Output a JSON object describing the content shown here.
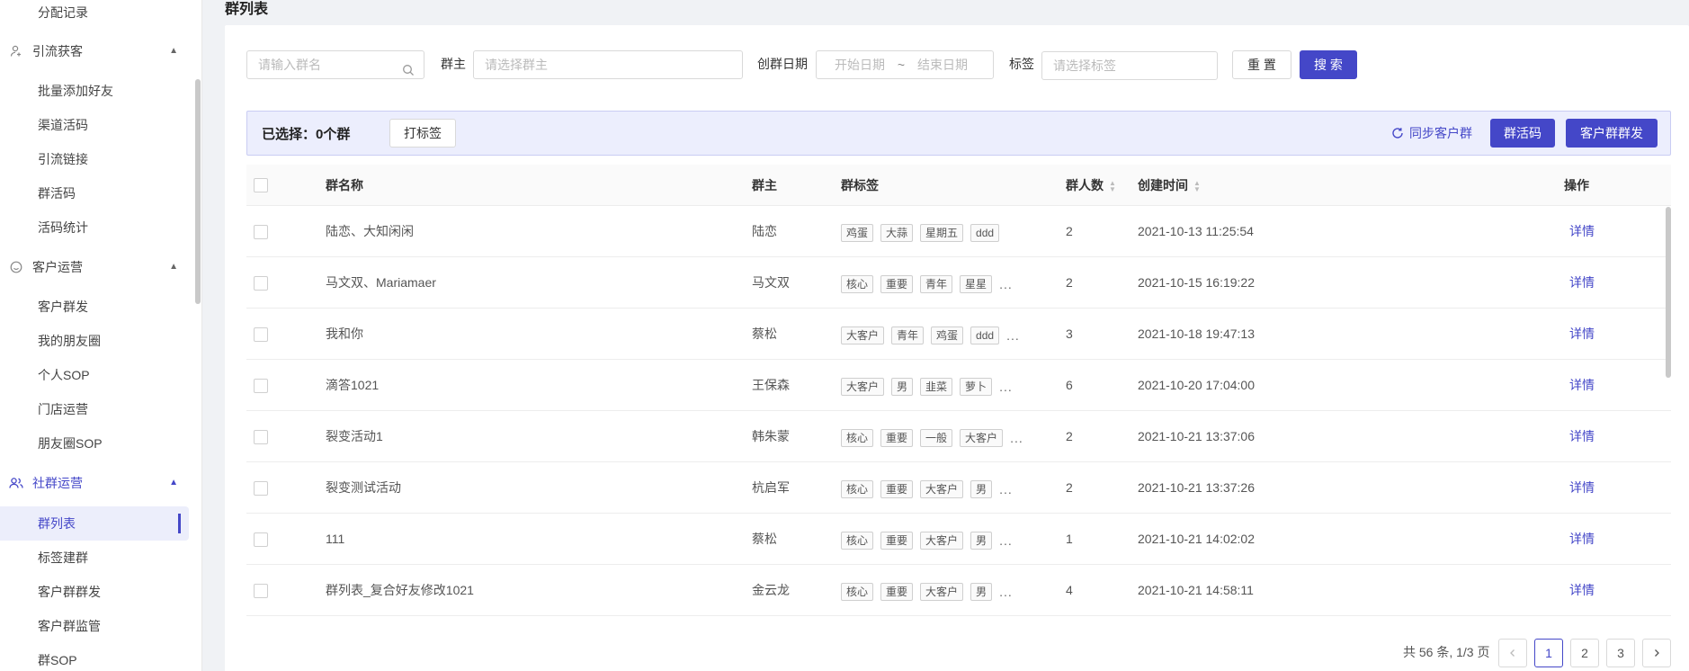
{
  "sidebar": {
    "items_top": [
      "分配记录"
    ],
    "groups": [
      {
        "label": "引流获客",
        "icon": "user-plus-icon",
        "children": [
          "批量添加好友",
          "渠道活码",
          "引流链接",
          "群活码",
          "活码统计"
        ]
      },
      {
        "label": "客户运营",
        "icon": "smile-face-icon",
        "children": [
          "客户群发",
          "我的朋友圈",
          "个人SOP",
          "门店运营",
          "朋友圈SOP"
        ]
      },
      {
        "label": "社群运营",
        "icon": "users-icon",
        "children": [
          "群列表",
          "标签建群",
          "客户群群发",
          "客户群监管",
          "群SOP"
        ]
      }
    ],
    "active_item": "群列表"
  },
  "page": {
    "title": "群列表"
  },
  "filters": {
    "group_name_placeholder": "请输入群名",
    "owner_label": "群主",
    "owner_placeholder": "请选择群主",
    "date_label": "创群日期",
    "start_placeholder": "开始日期",
    "date_sep": "~",
    "end_placeholder": "结束日期",
    "tag_label": "标签",
    "tag_placeholder": "请选择标签",
    "reset": "重 置",
    "search": "搜 索"
  },
  "selection": {
    "text": "已选择：0个群",
    "tag_button": "打标签",
    "sync_button": "同步客户群",
    "qrcode_button": "群活码",
    "broadcast_button": "客户群群发"
  },
  "table": {
    "columns": {
      "name": "群名称",
      "owner": "群主",
      "tags": "群标签",
      "count": "群人数",
      "created": "创建时间",
      "action": "操作"
    },
    "rows": [
      {
        "name": "陆恋、大知闲闲",
        "owner": "陆恋",
        "tags": [
          "鸡蛋",
          "大蒜",
          "星期五",
          "ddd"
        ],
        "more": "",
        "count": "2",
        "created": "2021-10-13 11:25:54",
        "action": "详情"
      },
      {
        "name": "马文双、Mariamaer",
        "owner": "马文双",
        "tags": [
          "核心",
          "重要",
          "青年",
          "星星"
        ],
        "more": "...",
        "count": "2",
        "created": "2021-10-15 16:19:22",
        "action": "详情"
      },
      {
        "name": "我和你",
        "owner": "蔡松",
        "tags": [
          "大客户",
          "青年",
          "鸡蛋",
          "ddd"
        ],
        "more": "...",
        "count": "3",
        "created": "2021-10-18 19:47:13",
        "action": "详情"
      },
      {
        "name": "滴答1021",
        "owner": "王保森",
        "tags": [
          "大客户",
          "男",
          "韭菜",
          "萝卜"
        ],
        "more": "...",
        "count": "6",
        "created": "2021-10-20 17:04:00",
        "action": "详情"
      },
      {
        "name": "裂变活动1",
        "owner": "韩朱蒙",
        "tags": [
          "核心",
          "重要",
          "一般",
          "大客户"
        ],
        "more": "...",
        "count": "2",
        "created": "2021-10-21 13:37:06",
        "action": "详情"
      },
      {
        "name": "裂变测试活动",
        "owner": "杭启军",
        "tags": [
          "核心",
          "重要",
          "大客户",
          "男"
        ],
        "more": "...",
        "count": "2",
        "created": "2021-10-21 13:37:26",
        "action": "详情"
      },
      {
        "name": "111",
        "owner": "蔡松",
        "tags": [
          "核心",
          "重要",
          "大客户",
          "男"
        ],
        "more": "...",
        "count": "1",
        "created": "2021-10-21 14:02:02",
        "action": "详情"
      },
      {
        "name": "群列表_复合好友修改1021",
        "owner": "金云龙",
        "tags": [
          "核心",
          "重要",
          "大客户",
          "男"
        ],
        "more": "...",
        "count": "4",
        "created": "2021-10-21 14:58:11",
        "action": "详情"
      }
    ]
  },
  "pagination": {
    "total_text": "共 56 条, 1/3 页",
    "pages": [
      "1",
      "2",
      "3"
    ],
    "current": "1",
    "prev": "<",
    "next": ">"
  },
  "colors": {
    "primary": "#4447c8",
    "selection_bg": "#eceefd"
  }
}
